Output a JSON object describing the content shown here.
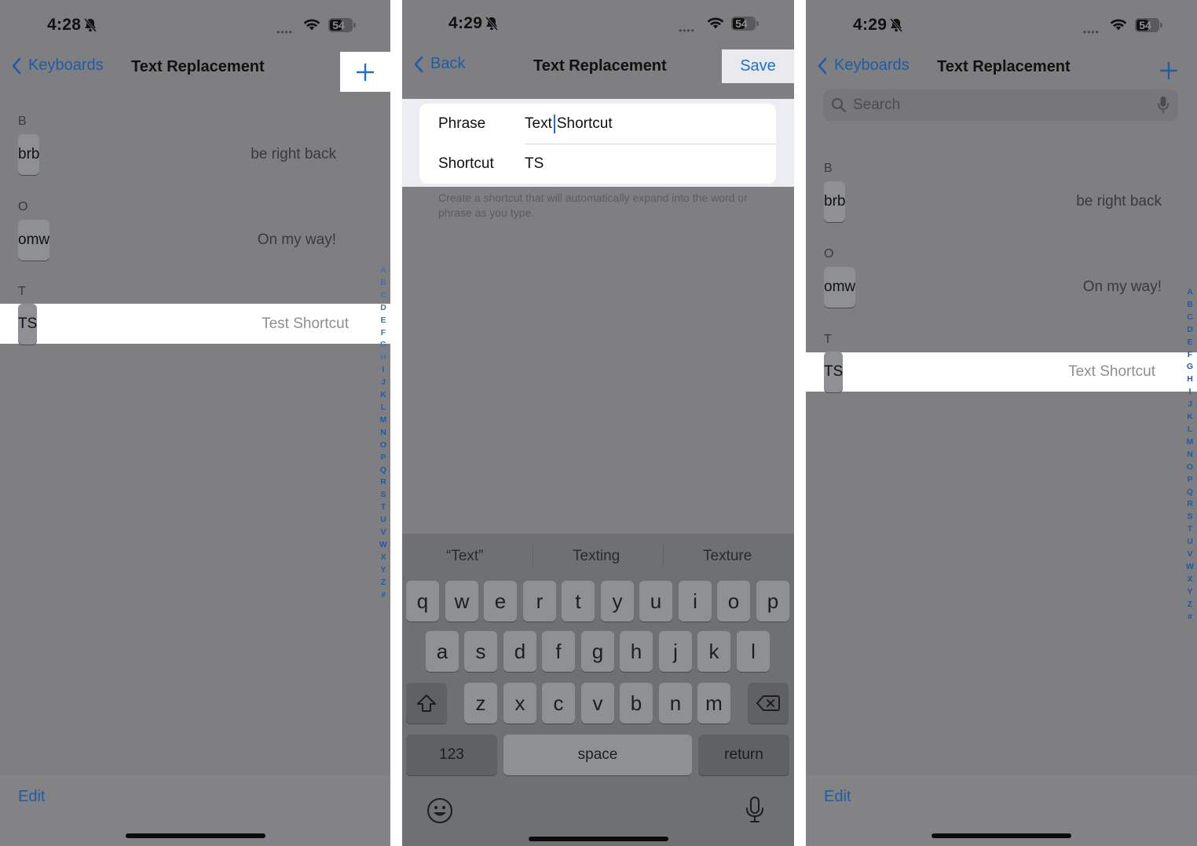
{
  "colors": {
    "accent": "#1e5ca8",
    "highlight": "#ffffff",
    "dim_background": "#7f7f82"
  },
  "panel1": {
    "status": {
      "time": "4:28",
      "battery": "54"
    },
    "nav": {
      "back_label": "Keyboards",
      "title": "Text Replacement",
      "add_icon": "plus-icon"
    },
    "sections": [
      {
        "letter": "B",
        "rows": [
          {
            "key": "brb",
            "value": "be right back"
          }
        ]
      },
      {
        "letter": "O",
        "rows": [
          {
            "key": "omw",
            "value": "On my way!"
          }
        ]
      },
      {
        "letter": "T",
        "rows": [
          {
            "key": "TS",
            "value": "Test Shortcut"
          }
        ]
      }
    ],
    "edit_label": "Edit"
  },
  "panel2": {
    "status": {
      "time": "4:29",
      "battery": "54"
    },
    "nav": {
      "back_label": "Back",
      "title": "Text Replacement",
      "save_label": "Save"
    },
    "form": {
      "phrase_label": "Phrase",
      "phrase_before_cursor": "Text",
      "phrase_after_cursor": "Shortcut",
      "shortcut_label": "Shortcut",
      "shortcut_value": "TS"
    },
    "hint": "Create a shortcut that will automatically expand into the word or phrase as you type.",
    "keyboard": {
      "suggestions": [
        "“Text”",
        "Texting",
        "Texture"
      ],
      "row1": [
        "q",
        "w",
        "e",
        "r",
        "t",
        "y",
        "u",
        "i",
        "o",
        "p"
      ],
      "row2": [
        "a",
        "s",
        "d",
        "f",
        "g",
        "h",
        "j",
        "k",
        "l"
      ],
      "row3": [
        "z",
        "x",
        "c",
        "v",
        "b",
        "n",
        "m"
      ],
      "numbers_label": "123",
      "space_label": "space",
      "return_label": "return"
    }
  },
  "panel3": {
    "status": {
      "time": "4:29",
      "battery": "54"
    },
    "nav": {
      "back_label": "Keyboards",
      "title": "Text Replacement",
      "add_icon": "plus-icon"
    },
    "search_placeholder": "Search",
    "sections": [
      {
        "letter": "B",
        "rows": [
          {
            "key": "brb",
            "value": "be right back"
          }
        ]
      },
      {
        "letter": "O",
        "rows": [
          {
            "key": "omw",
            "value": "On my way!"
          }
        ]
      },
      {
        "letter": "T",
        "rows": [
          {
            "key": "TS",
            "value": "Text Shortcut"
          }
        ]
      }
    ],
    "edit_label": "Edit"
  },
  "index_letters": [
    "A",
    "B",
    "C",
    "D",
    "E",
    "F",
    "G",
    "H",
    "I",
    "J",
    "K",
    "L",
    "M",
    "N",
    "O",
    "P",
    "Q",
    "R",
    "S",
    "T",
    "U",
    "V",
    "W",
    "X",
    "Y",
    "Z",
    "#"
  ]
}
